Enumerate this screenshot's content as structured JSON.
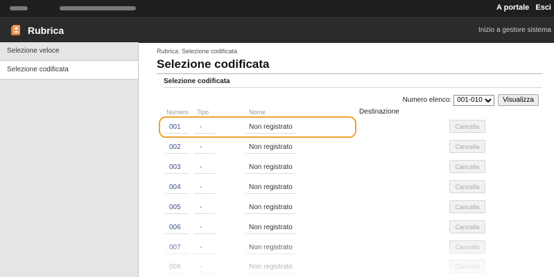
{
  "topbar": {
    "portal_link": "A portale",
    "logout_link": "Esci"
  },
  "header": {
    "title": "Rubrica",
    "system_link": "Inizio a gestore sistema"
  },
  "sidebar": {
    "items": [
      {
        "label": "Selezione veloce"
      },
      {
        "label": "Selezione codificata"
      }
    ]
  },
  "main": {
    "breadcrumb": "Rubrica: Selezione codificata",
    "title": "Selezione codificata",
    "section_title": "Selezione codificata",
    "list_label": "Numero elenco:",
    "list_select_value": "001-010",
    "view_button": "Visualizza",
    "columns": {
      "number": "Numero",
      "type": "Tipo",
      "name": "Nome",
      "destination": "Destinazione"
    },
    "rows": [
      {
        "number": "001",
        "type": "-",
        "name": "Non registrato",
        "action": "Cancella"
      },
      {
        "number": "002",
        "type": "-",
        "name": "Non registrato",
        "action": "Cancella"
      },
      {
        "number": "003",
        "type": "-",
        "name": "Non registrato",
        "action": "Cancella"
      },
      {
        "number": "004",
        "type": "-",
        "name": "Non registrato",
        "action": "Cancella"
      },
      {
        "number": "005",
        "type": "-",
        "name": "Non registrato",
        "action": "Cancella"
      },
      {
        "number": "006",
        "type": "-",
        "name": "Non registrato",
        "action": "Cancella"
      },
      {
        "number": "007",
        "type": "-",
        "name": "Non registrato",
        "action": "Cancella"
      },
      {
        "number": "008",
        "type": "-",
        "name": "Non registrato",
        "action": "Cancella"
      }
    ]
  },
  "colors": {
    "highlight": "#f0a030",
    "link": "#3a4e86",
    "topbar": "#1f1f1f"
  }
}
